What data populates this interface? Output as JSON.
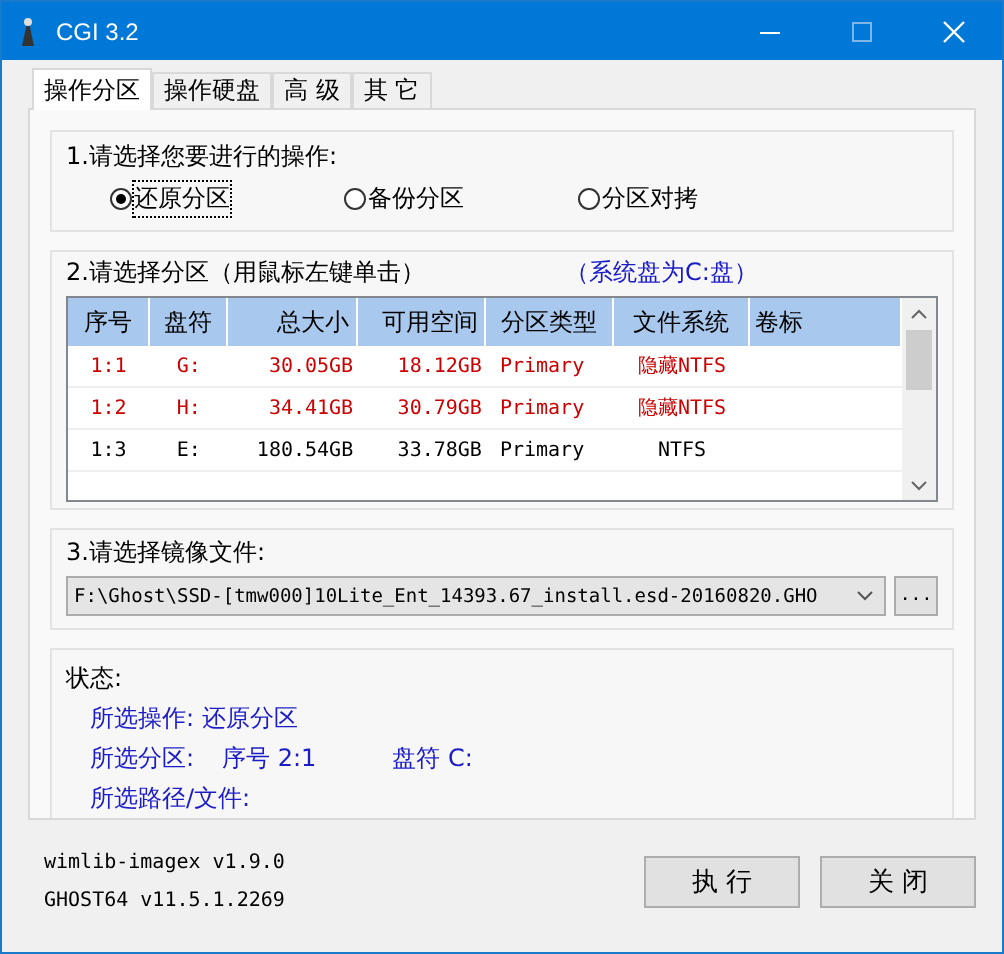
{
  "window": {
    "title": "CGI 3.2"
  },
  "tabs": [
    {
      "label": "操作分区",
      "selected": true
    },
    {
      "label": "操作硬盘",
      "selected": false
    },
    {
      "label": "高 级",
      "selected": false
    },
    {
      "label": "其 它",
      "selected": false
    }
  ],
  "operation": {
    "label": "1.请选择您要进行的操作:",
    "options": [
      {
        "label": "还原分区",
        "selected": true
      },
      {
        "label": "备份分区",
        "selected": false
      },
      {
        "label": "分区对拷",
        "selected": false
      }
    ]
  },
  "partitions": {
    "label": "2.请选择分区（用鼠标左键单击）",
    "system_note": "（系统盘为C:盘）",
    "columns": [
      "序号",
      "盘符",
      "总大小",
      "可用空间",
      "分区类型",
      "文件系统",
      "卷标"
    ],
    "rows": [
      {
        "cells": [
          "1:1",
          "G:",
          "30.05GB",
          "18.12GB",
          "Primary",
          "隐藏NTFS",
          ""
        ],
        "color": "#cc0000"
      },
      {
        "cells": [
          "1:2",
          "H:",
          "34.41GB",
          "30.79GB",
          "Primary",
          "隐藏NTFS",
          ""
        ],
        "color": "#cc0000"
      },
      {
        "cells": [
          "1:3",
          "E:",
          "180.54GB",
          "33.78GB",
          "Primary",
          "NTFS",
          ""
        ],
        "color": "#000000"
      }
    ]
  },
  "image_file": {
    "label": "3.请选择镜像文件:",
    "value": "F:\\Ghost\\SSD-[tmw000]10Lite_Ent_14393.67_install.esd-20160820.GHO",
    "browse": "..."
  },
  "status": {
    "label": "状态:",
    "operation": "所选操作: 还原分区",
    "partition_label": "所选分区:",
    "partition_number": "序号 2:1",
    "partition_drive": "盘符 C:",
    "path_label": "所选路径/文件:"
  },
  "versions": [
    "wimlib-imagex v1.9.0",
    "GHOST64 v11.5.1.2269"
  ],
  "buttons": [
    "执 行",
    "关 闭"
  ]
}
